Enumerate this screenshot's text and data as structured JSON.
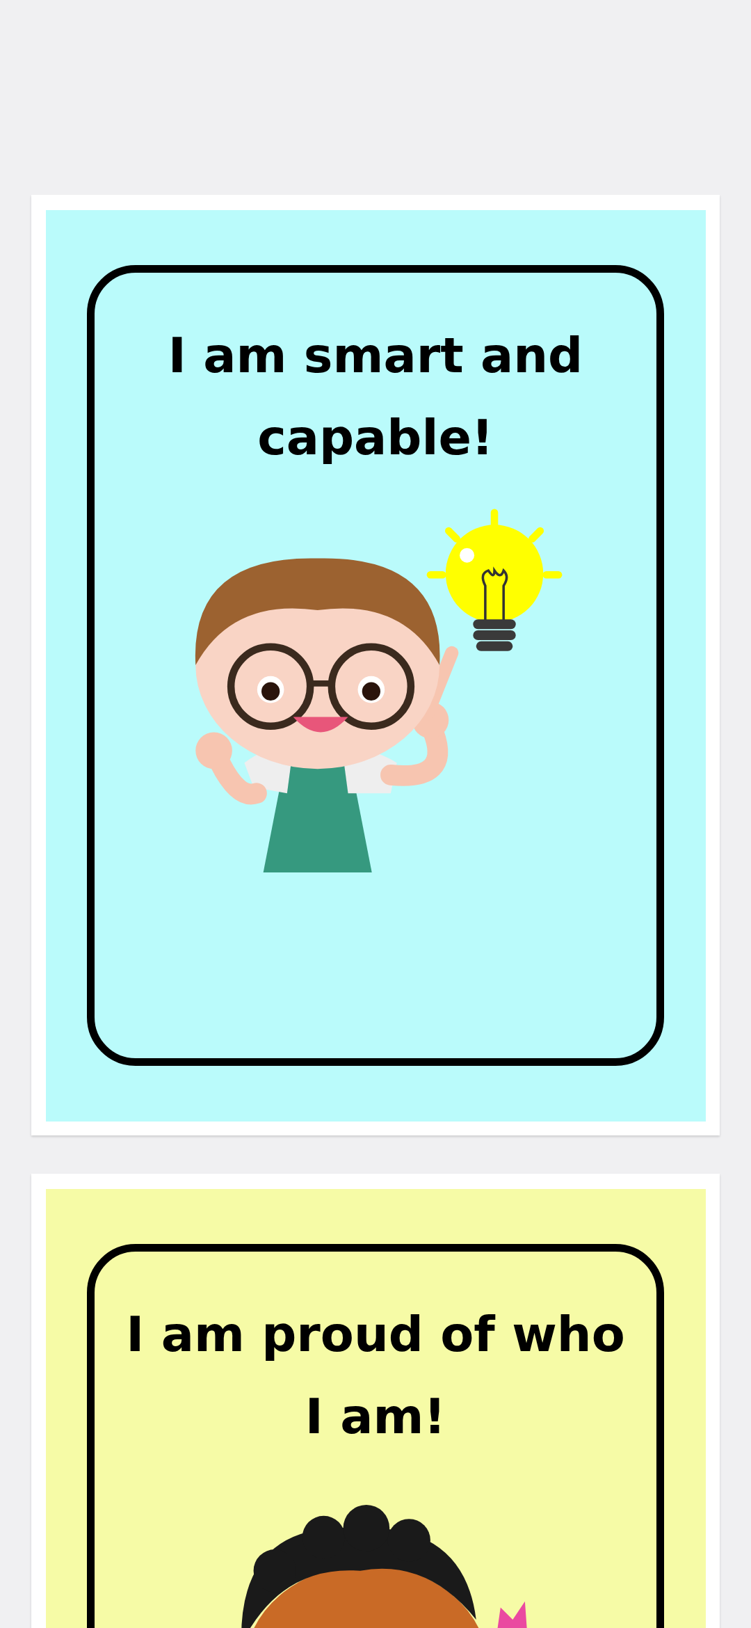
{
  "pages": [
    {
      "kind": "idea",
      "color": "#bafbfb",
      "affirmation": "I am smart and capable!"
    },
    {
      "kind": "proud",
      "color": "#f6fba6",
      "affirmation": "I am proud of who I am!"
    }
  ]
}
